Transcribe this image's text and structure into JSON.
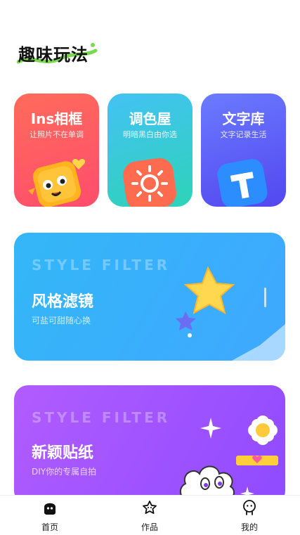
{
  "header": {
    "title": "趣味玩法"
  },
  "cards": [
    {
      "title": "Ins相框",
      "subtitle": "让照片不在单调",
      "icon": "yellow-monster-icon"
    },
    {
      "title": "调色屋",
      "subtitle": "明暗黑白由你选",
      "icon": "sun-icon"
    },
    {
      "title": "文字库",
      "subtitle": "文字记录生活",
      "icon": "letter-t-icon"
    }
  ],
  "banners": [
    {
      "en_label": "STYLE FILTER",
      "title": "风格滤镜",
      "subtitle": "可盐可甜随心换",
      "icon": "star-icon"
    },
    {
      "en_label": "STYLE FILTER",
      "title": "新颖贴纸",
      "subtitle": "DIY你的专属自拍",
      "icon": "cloud-sticker-icon"
    }
  ],
  "tabbar": [
    {
      "label": "首页",
      "icon": "home-icon",
      "active": true
    },
    {
      "label": "作品",
      "icon": "star-outline-icon",
      "active": false
    },
    {
      "label": "我的",
      "icon": "profile-icon",
      "active": false
    }
  ],
  "colors": {
    "card1": "#ff5a64",
    "card2": "#3fc9d9",
    "card3": "#5f62f7",
    "banner1": "#38b0fb",
    "banner2": "#a455ff",
    "accent_green": "#6fd34b"
  }
}
